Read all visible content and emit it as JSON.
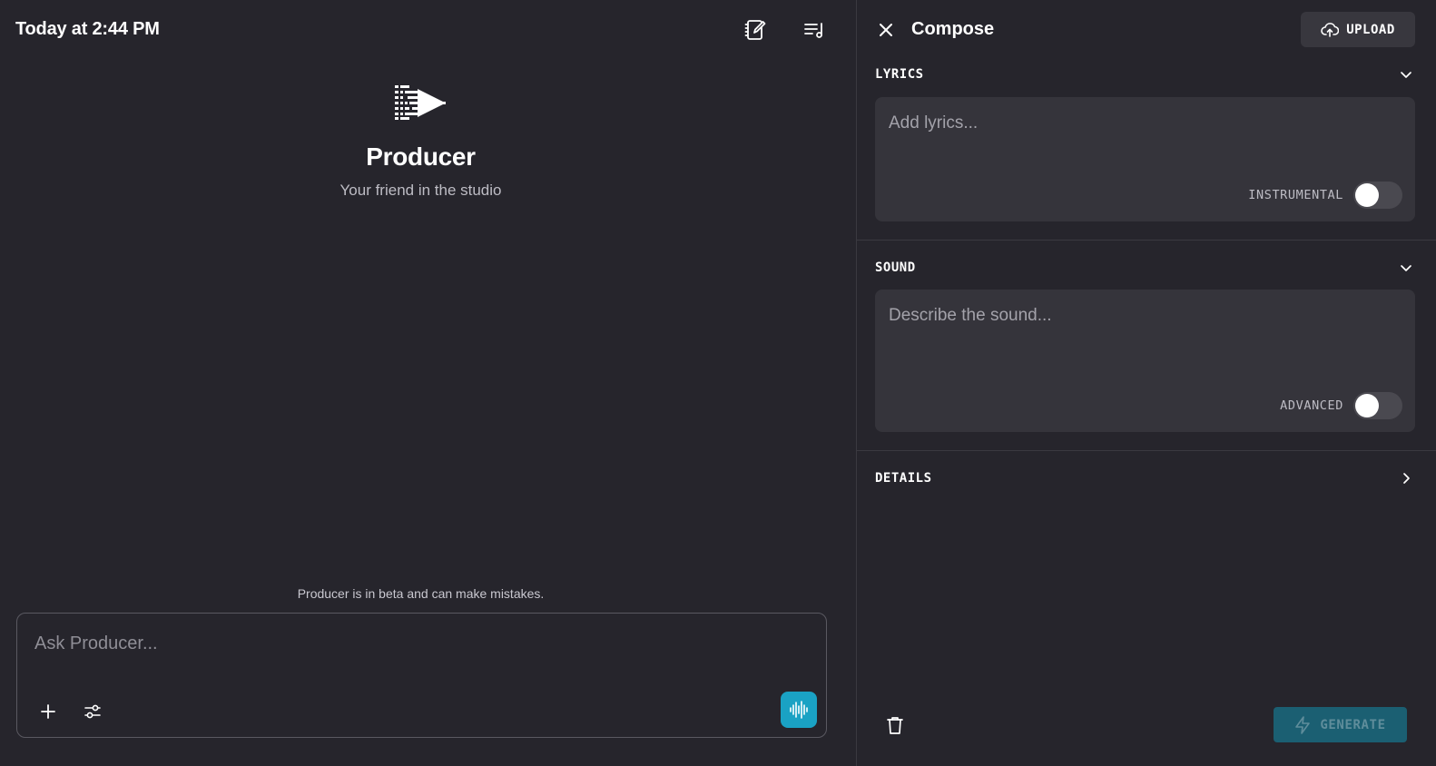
{
  "header": {
    "title": "Today at 2:44 PM",
    "icons": [
      "notebook-edit-icon",
      "playlist-music-icon"
    ]
  },
  "hero": {
    "logo": "producer-logo",
    "title": "Producer",
    "subtitle": "Your friend in the studio"
  },
  "chat": {
    "disclaimer": "Producer is in beta and can make mistakes.",
    "placeholder": "Ask Producer...",
    "icons": [
      "plus-icon",
      "sliders-icon",
      "waveform-icon"
    ],
    "voice_button_color": "#1aa2c4"
  },
  "compose": {
    "title": "Compose",
    "upload_label": "UPLOAD",
    "lyrics": {
      "label": "LYRICS",
      "placeholder": "Add lyrics...",
      "toggle_label": "INSTRUMENTAL",
      "toggle_on": false
    },
    "sound": {
      "label": "SOUND",
      "placeholder": "Describe the sound...",
      "toggle_label": "ADVANCED",
      "toggle_on": false
    },
    "details": {
      "label": "DETAILS"
    },
    "generate_label": "GENERATE"
  },
  "colors": {
    "background": "#26252c",
    "field": "#35343b",
    "accent": "#1aa2c4",
    "generate_disabled": "#1b5f72"
  }
}
